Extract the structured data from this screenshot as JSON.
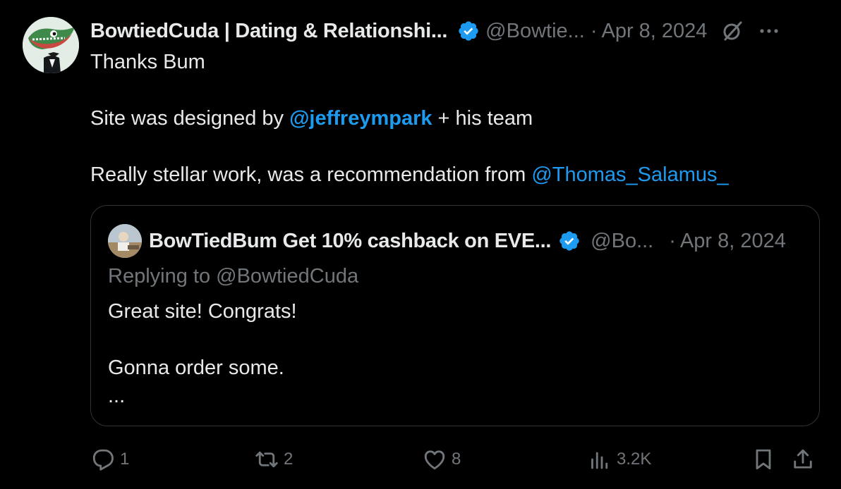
{
  "tweet": {
    "author_name": "BowtiedCuda | Dating & Relationshi...",
    "handle": "@Bowtie...",
    "dot": "·",
    "date": "Apr 8, 2024",
    "more": "···",
    "lines": {
      "l1": "Thanks Bum",
      "l2_pre": "Site was designed by ",
      "l2_mention": "@jeffreympark",
      "l2_post": " + his team",
      "l3_pre": "Really stellar work, was a recommendation from ",
      "l3_mention": "@Thomas_Salamus_"
    }
  },
  "quote": {
    "author_name": "BowTiedBum Get 10% cashback on EVE...",
    "handle": "@Bo...",
    "dot": "·",
    "date": "Apr 8, 2024",
    "replying": "Replying to @BowtiedCuda",
    "line1": "Great site!  Congrats!",
    "line2": "Gonna order some.",
    "line3": "..."
  },
  "actions": {
    "replies": "1",
    "reposts": "2",
    "likes": "8",
    "views": "3.2K"
  },
  "colors": {
    "background": "#000000",
    "text": "#e7e9ea",
    "muted": "#71767b",
    "accent": "#1d9bf0",
    "border": "#2f3336"
  }
}
